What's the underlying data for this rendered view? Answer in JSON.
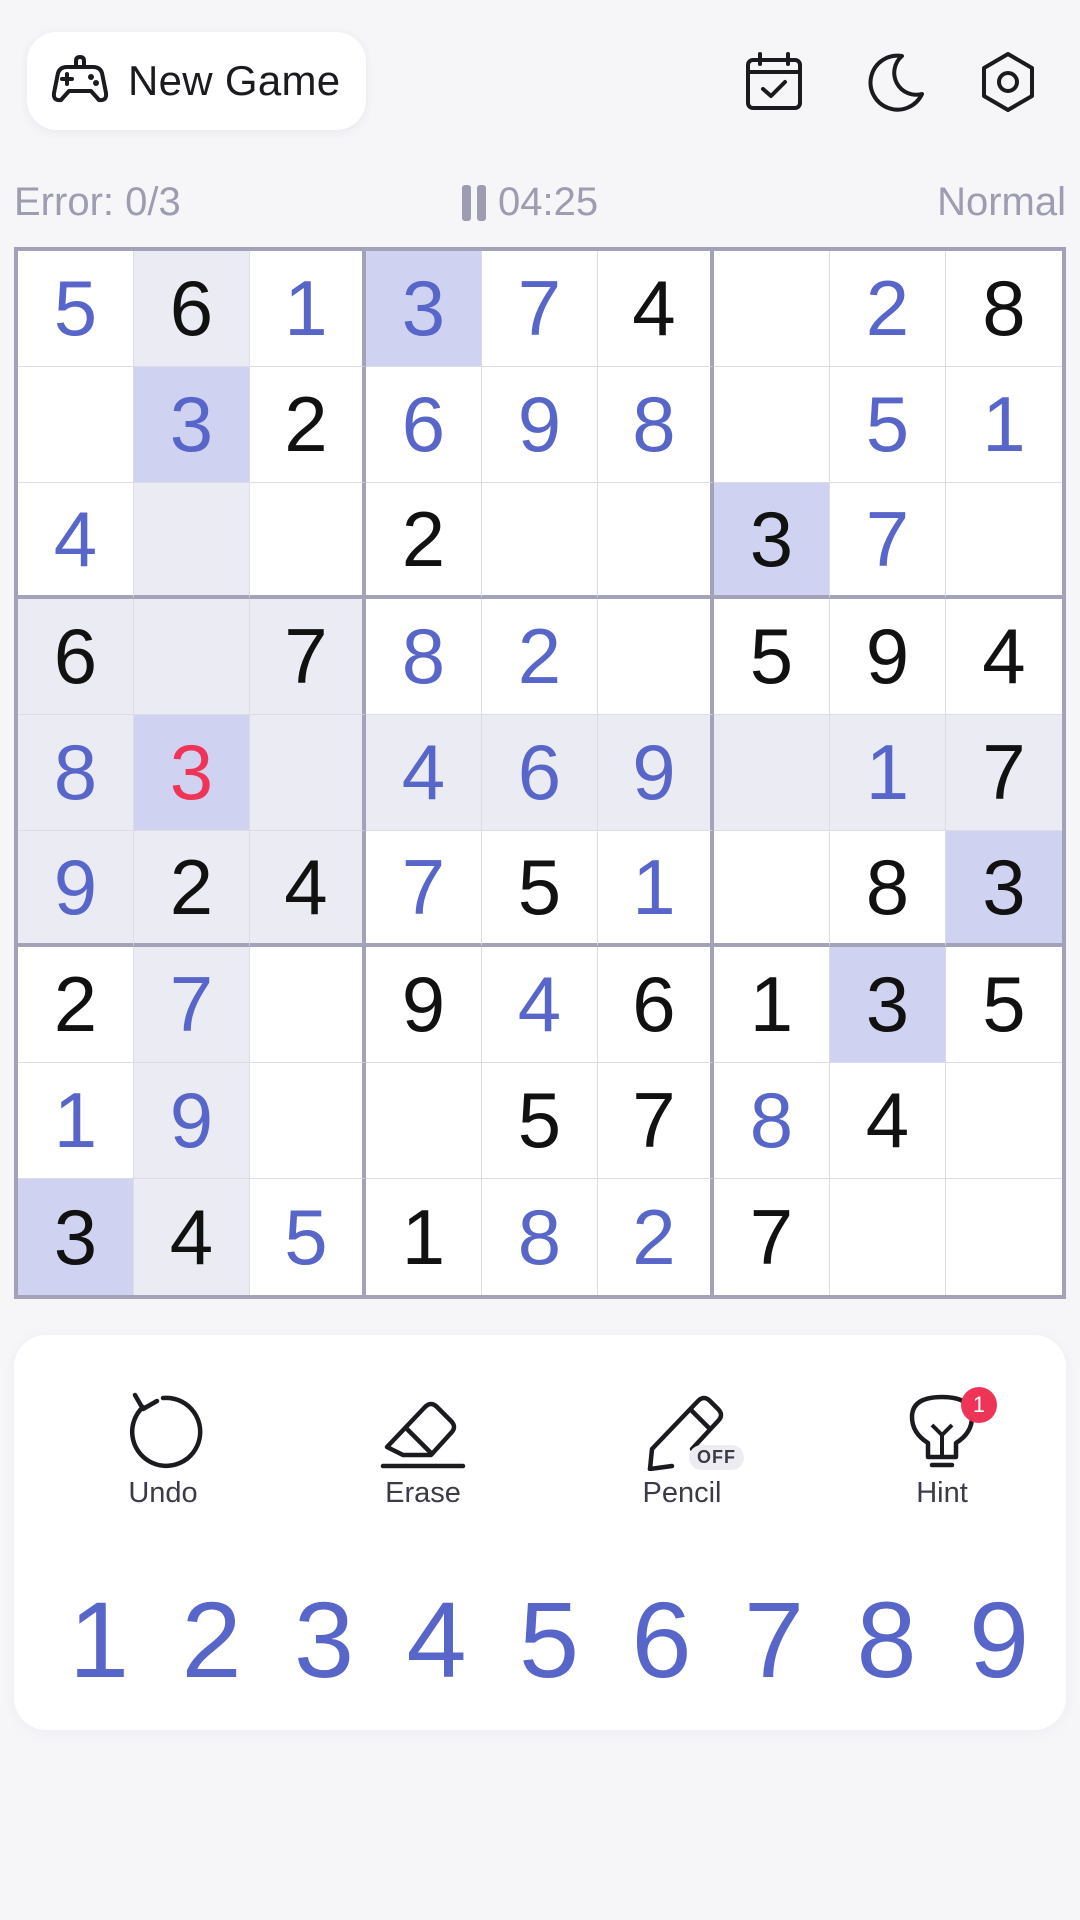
{
  "header": {
    "new_game_label": "New Game",
    "icons": [
      "gamepad-icon",
      "daily-challenge-calendar-icon",
      "dark-mode-moon-icon",
      "settings-gear-icon"
    ]
  },
  "status": {
    "error_text": "Error: 0/3",
    "timer_text": "04:25",
    "difficulty": "Normal"
  },
  "colors": {
    "accent": "#5865c9",
    "given_digit": "#111111",
    "error_digit": "#ef3557",
    "highlight_same": "#cfd3f1",
    "highlight_related": "#ebebf3",
    "badge_red": "#ef3557"
  },
  "board": {
    "selected": [
      4,
      1
    ],
    "digits": [
      [
        "5",
        "6",
        "1",
        "3",
        "7",
        "4",
        "",
        "2",
        "8"
      ],
      [
        "",
        "3",
        "2",
        "6",
        "9",
        "8",
        "",
        "5",
        "1"
      ],
      [
        "4",
        "",
        "",
        "2",
        "",
        "",
        "3",
        "7",
        ""
      ],
      [
        "6",
        "",
        "7",
        "8",
        "2",
        "",
        "5",
        "9",
        "4"
      ],
      [
        "8",
        "3",
        "",
        "4",
        "6",
        "9",
        "",
        "1",
        "7"
      ],
      [
        "9",
        "2",
        "4",
        "7",
        "5",
        "1",
        "",
        "8",
        "3"
      ],
      [
        "2",
        "7",
        "",
        "9",
        "4",
        "6",
        "1",
        "3",
        "5"
      ],
      [
        "1",
        "9",
        "",
        "",
        "5",
        "7",
        "8",
        "4",
        ""
      ],
      [
        "3",
        "4",
        "5",
        "1",
        "8",
        "2",
        "7",
        "",
        ""
      ]
    ],
    "kinds": [
      [
        "u",
        "g",
        "u",
        "u",
        "u",
        "g",
        "",
        "u",
        "g"
      ],
      [
        "",
        "u",
        "g",
        "u",
        "u",
        "u",
        "",
        "u",
        "u"
      ],
      [
        "u",
        "",
        "",
        "g",
        "",
        "",
        "g",
        "u",
        ""
      ],
      [
        "g",
        "",
        "g",
        "u",
        "u",
        "",
        "g",
        "g",
        "g"
      ],
      [
        "u",
        "e",
        "",
        "u",
        "u",
        "u",
        "",
        "u",
        "g"
      ],
      [
        "u",
        "g",
        "g",
        "u",
        "g",
        "u",
        "",
        "g",
        "g"
      ],
      [
        "g",
        "u",
        "",
        "g",
        "u",
        "g",
        "g",
        "g",
        "g"
      ],
      [
        "u",
        "u",
        "",
        "",
        "g",
        "g",
        "u",
        "g",
        ""
      ],
      [
        "g",
        "g",
        "u",
        "g",
        "u",
        "u",
        "g",
        "",
        ""
      ]
    ]
  },
  "tools": [
    {
      "name": "undo",
      "label": "Undo"
    },
    {
      "name": "erase",
      "label": "Erase"
    },
    {
      "name": "pencil",
      "label": "Pencil",
      "badge": "OFF"
    },
    {
      "name": "hint",
      "label": "Hint",
      "badge": "1"
    }
  ],
  "numpad": [
    "1",
    "2",
    "3",
    "4",
    "5",
    "6",
    "7",
    "8",
    "9"
  ]
}
